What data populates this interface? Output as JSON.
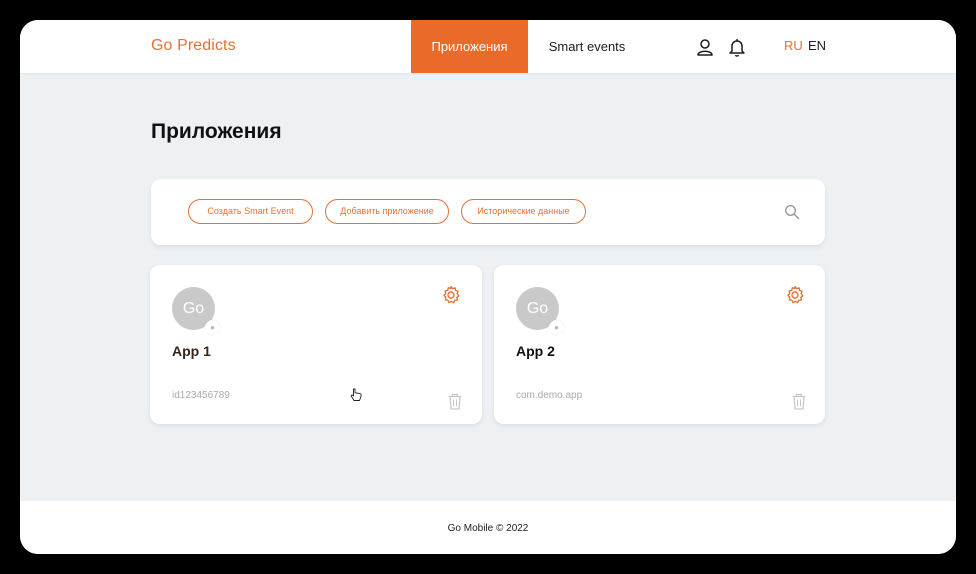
{
  "header": {
    "logo": "Go Predicts",
    "nav": [
      {
        "label": "Приложения",
        "active": true
      },
      {
        "label": "Smart events",
        "active": false
      }
    ],
    "icons": [
      "user-icon",
      "bell-icon"
    ],
    "languages": [
      {
        "label": "RU",
        "active": true
      },
      {
        "label": "EN",
        "active": false
      }
    ]
  },
  "page": {
    "title": "Приложения"
  },
  "toolbar": {
    "buttons": [
      {
        "label": "Создать Smart Event"
      },
      {
        "label": "Добавить приложение"
      },
      {
        "label": "Исторические данные"
      }
    ],
    "search_icon": "search-icon"
  },
  "apps": [
    {
      "avatar": "Go",
      "platform_icon": "apple-icon",
      "name": "App 1",
      "id": "id123456789"
    },
    {
      "avatar": "Go",
      "platform_icon": "android-icon",
      "name": "App 2",
      "id": "com.demo.app"
    }
  ],
  "footer": {
    "copyright": "Go Mobile © 2022"
  },
  "colors": {
    "accent": "#ea6a2a",
    "background": "#edf1f4",
    "card": "#ffffff",
    "muted": "#a9a9a9"
  }
}
